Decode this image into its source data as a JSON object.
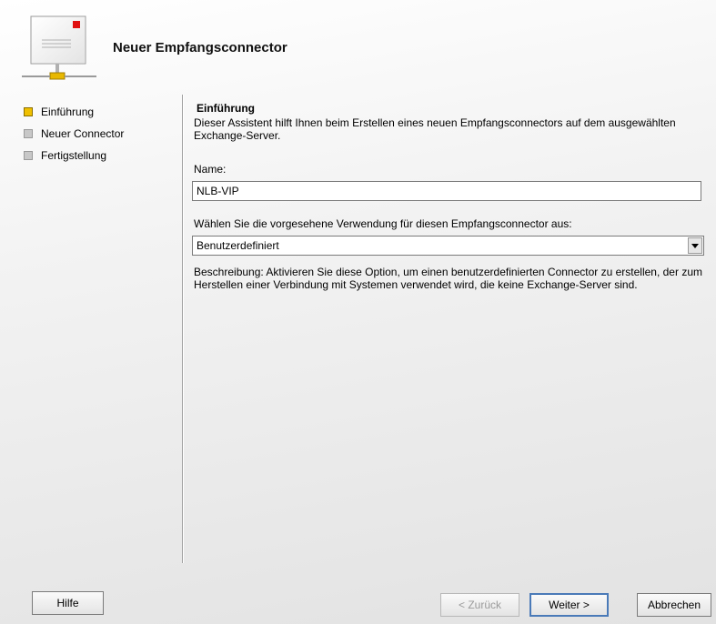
{
  "header": {
    "title": "Neuer Empfangsconnector",
    "icon": "mail-connector-icon"
  },
  "steps": [
    {
      "label": "Einführung",
      "state": "active"
    },
    {
      "label": "Neuer Connector",
      "state": "inactive"
    },
    {
      "label": "Fertigstellung",
      "state": "inactive"
    }
  ],
  "main": {
    "section_title": "Einführung",
    "section_desc": "Dieser Assistent hilft Ihnen beim Erstellen eines neuen Empfangsconnectors auf dem ausgewählten Exchange-Server.",
    "name_label": "Name:",
    "name_value": "NLB-VIP",
    "usage_label": "Wählen Sie die vorgesehene Verwendung für diesen Empfangsconnector aus:",
    "usage_value": "Benutzerdefiniert",
    "usage_desc": "Beschreibung: Aktivieren Sie diese Option, um einen benutzerdefinierten Connector zu erstellen, der zum Herstellen einer Verbindung mit Systemen verwendet wird, die keine Exchange-Server sind."
  },
  "buttons": {
    "help": "Hilfe",
    "back": "< Zurück",
    "next": "Weiter >",
    "cancel": "Abbrechen"
  },
  "colors": {
    "active_step": "#f0c000",
    "inactive_step": "#c8c8c8",
    "envelope_accent": "#e01010",
    "connector": "#e8b800"
  }
}
